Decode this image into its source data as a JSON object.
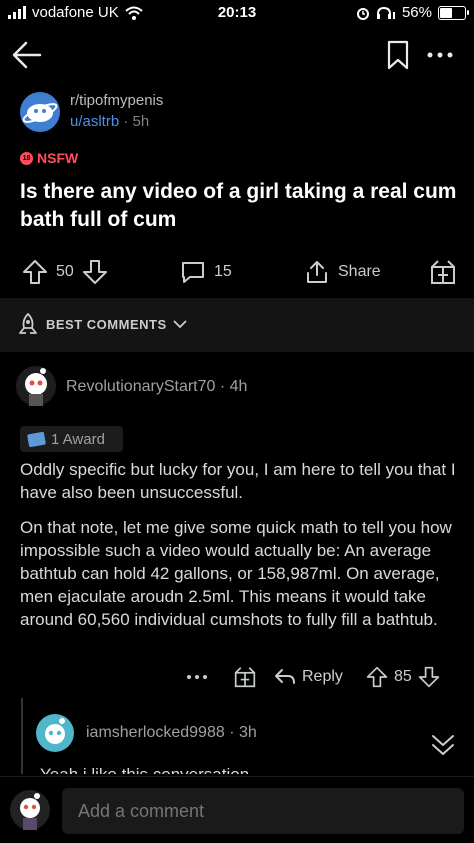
{
  "status": {
    "carrier": "vodafone UK",
    "time": "20:13",
    "battery": "56%",
    "battery_level": 0.56
  },
  "post": {
    "subreddit": "r/tipofmypenis",
    "author": "u/asltrb",
    "age": "5h",
    "nsfw_label": "NSFW",
    "title": "Is there any video of a girl taking a real cum bath full of cum",
    "upvotes": "50",
    "comments": "15",
    "share_label": "Share"
  },
  "sort": {
    "label": "BEST COMMENTS"
  },
  "comment": {
    "author": "RevolutionaryStart70",
    "age": "4h",
    "award": "1 Award",
    "paragraphs": [
      "Oddly specific but lucky for you, I am here to tell you that I have also been unsuccessful.",
      "On that note, let me give some quick math to tell you how impossible such a video would actually be: An average bathtub can hold 42 gallons, or 158,987ml. On average, men ejaculate aroudn 2.5ml. This means it would take around 60,560 individual cumshots to fully fill a bathtub."
    ],
    "reply_label": "Reply",
    "score": "85"
  },
  "reply": {
    "author": "iamsherlocked9988",
    "age": "3h",
    "preview": "Yeah i like this conversation"
  },
  "composer": {
    "placeholder": "Add a comment"
  },
  "colors": {
    "background": "#000000",
    "nsfw": "#ff4d5e",
    "username": "#4f8fe8",
    "subreddit_icon": "#3f7fd1"
  }
}
